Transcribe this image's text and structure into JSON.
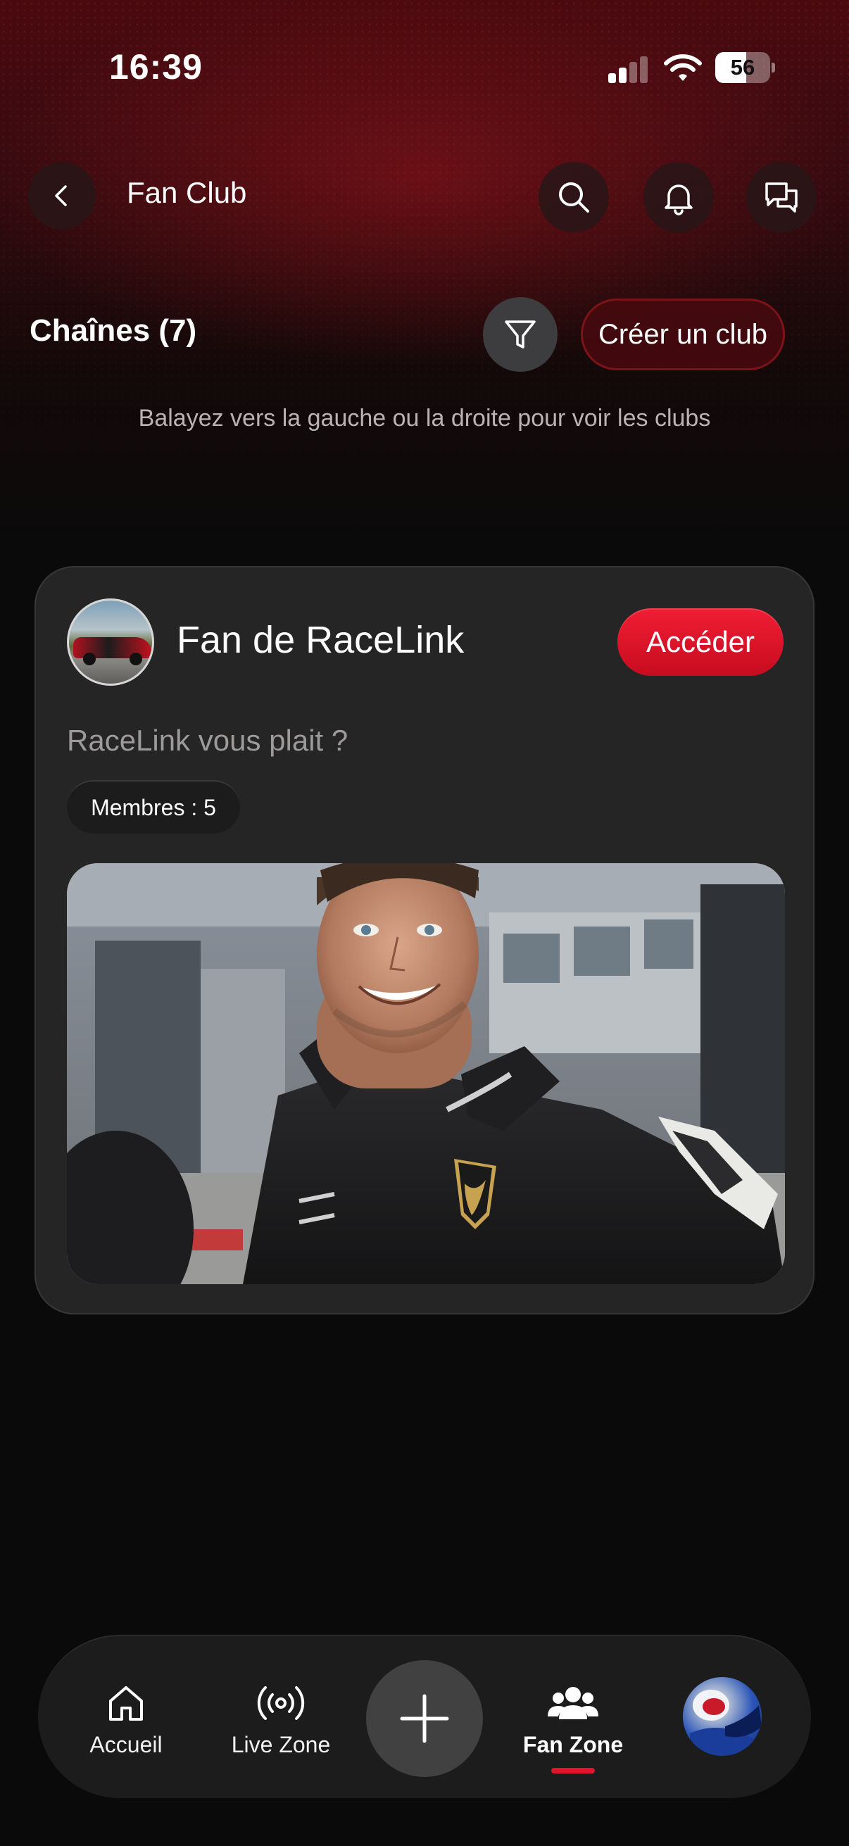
{
  "status_bar": {
    "time": "16:39",
    "battery": "56",
    "battery_level": 0.56
  },
  "header": {
    "title": "Fan Club",
    "back_icon": "chevron-left-icon",
    "actions": [
      "search-icon",
      "bell-icon",
      "chat-icon"
    ]
  },
  "section": {
    "title": "Chaînes (7)",
    "filter_icon": "filter-icon",
    "create_label": "Créer un club"
  },
  "hint": "Balayez vers la gauche ou la droite pour voir les clubs",
  "club": {
    "name": "Fan de RaceLink",
    "access_label": "Accéder",
    "description": "RaceLink vous plait ?",
    "members": "Membres : 5"
  },
  "nav": {
    "items": [
      {
        "label": "Accueil",
        "icon": "home-icon",
        "active": false
      },
      {
        "label": "Live Zone",
        "icon": "broadcast-icon",
        "active": false
      },
      {
        "label": "Fan Zone",
        "icon": "users-icon",
        "active": true
      }
    ],
    "plus_icon": "plus-icon",
    "profile_icon": "profile-avatar"
  },
  "colors": {
    "accent": "#e0142a",
    "card": "#262525",
    "background": "#0b0a0a"
  }
}
